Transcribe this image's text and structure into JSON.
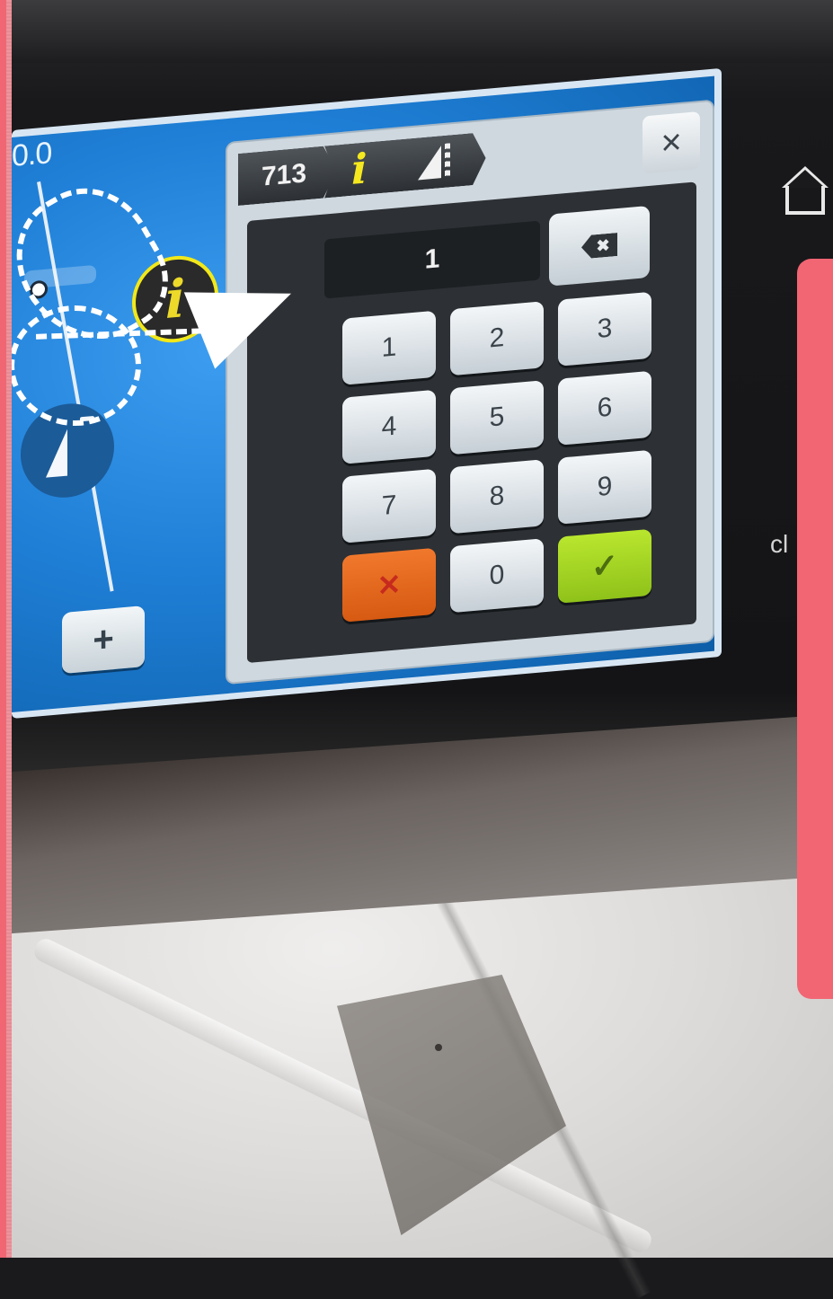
{
  "dialog": {
    "tabs": [
      {
        "label": "713",
        "icon": "pattern-number"
      },
      {
        "label": "i",
        "icon": "info-icon"
      },
      {
        "label": "",
        "icon": "stitch-width-icon"
      }
    ],
    "close_label": "×",
    "display_value": "1",
    "backspace_label": "✖",
    "keys": [
      "1",
      "2",
      "3",
      "4",
      "5",
      "6",
      "7",
      "8",
      "9"
    ],
    "zero_label": "0",
    "cancel_label": "✕",
    "confirm_label": "✓"
  },
  "left_panel": {
    "value_text": "0.0",
    "plus_label": "+",
    "info_badge": "i"
  },
  "right_side": {
    "partial_text": "cl"
  },
  "colors": {
    "screen_blue": "#1f7fd6",
    "cancel_orange": "#e4661c",
    "confirm_green": "#a3d325",
    "info_yellow": "#f2e81a",
    "accent_pink": "#f26573"
  }
}
